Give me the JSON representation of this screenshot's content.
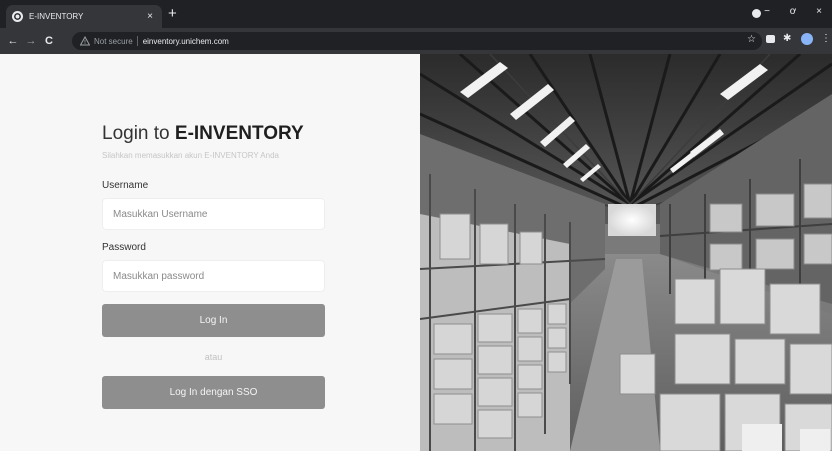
{
  "browser": {
    "tab_title": "E-INVENTORY",
    "tab_close": "×",
    "new_tab": "+",
    "not_secure": "Not secure",
    "url": "einventory.unichem.com",
    "back": "←",
    "forward": "→",
    "reload": "C",
    "star": "☆",
    "minimize": "−",
    "maximize": "ơ",
    "close": "×",
    "icons": [
      "back-icon",
      "forward-icon",
      "reload-icon",
      "warning-icon",
      "star-icon",
      "extension-icon",
      "puzzle-icon",
      "profile-icon",
      "menu-icon"
    ]
  },
  "login": {
    "title_prefix": "Login to ",
    "title_brand": "E-INVENTORY",
    "subtitle": "Silahkan memasukkan akun E-INVENTORY Anda",
    "username_label": "Username",
    "username_placeholder": "Masukkan Username",
    "password_label": "Password",
    "password_placeholder": "Masukkan password",
    "login_button": "Log In",
    "or_text": "atau",
    "sso_button": "Log In dengan SSO"
  },
  "colors": {
    "page_bg": "#f7f7f7",
    "button_bg": "#8e8e8e",
    "chrome_bg": "#202124",
    "toolbar_bg": "#35363a"
  }
}
